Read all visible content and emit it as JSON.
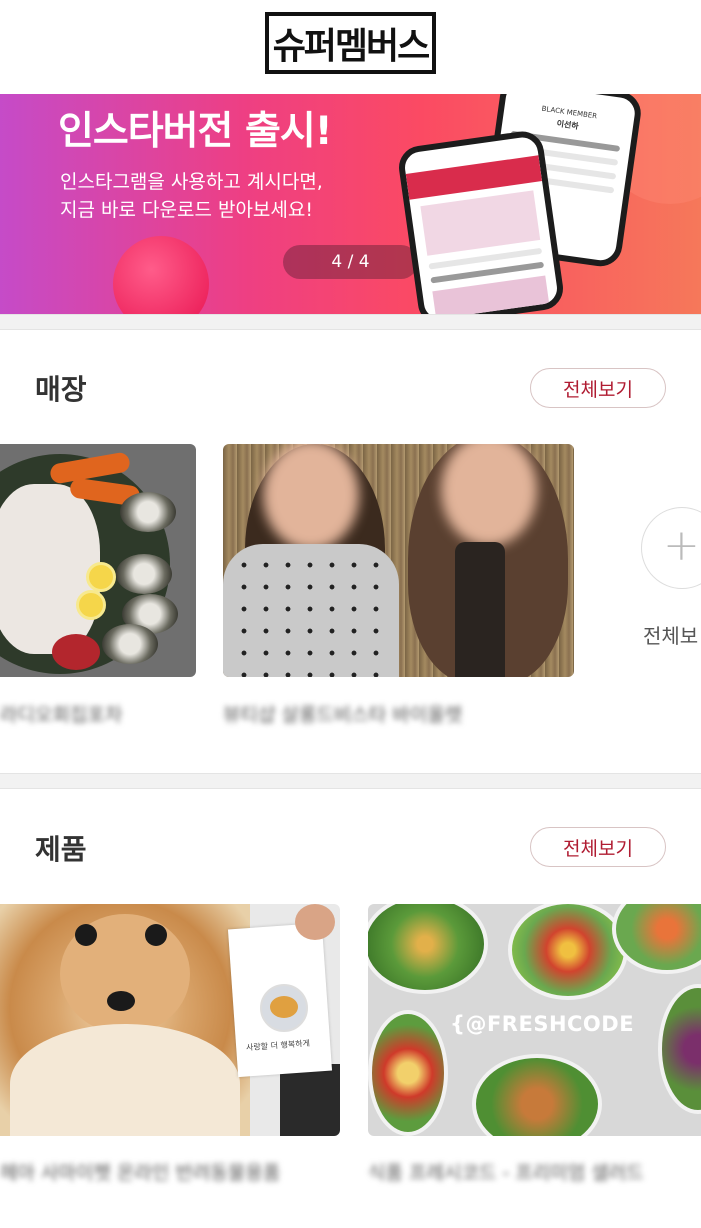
{
  "header": {
    "logo_text": "슈퍼멤버스"
  },
  "banner": {
    "title": "인스타버전 출시!",
    "subtitle_lines": [
      "인스타그램을 사용하고 계시다면,",
      "지금 바로 다운로드 받아보세요!"
    ],
    "pager": "4 / 4",
    "phone_back_label": "BLACK MEMBER",
    "phone_back_name": "이선하"
  },
  "stores": {
    "title": "매장",
    "view_all": "전체보기",
    "items": [
      {
        "caption": "라디오회집포차"
      },
      {
        "caption": "뷰티샵 살롱드비스타 바이올렛"
      }
    ],
    "more_label": "전체보"
  },
  "products": {
    "title": "제품",
    "view_all": "전체보기",
    "items": [
      {
        "caption": "헤아 사마이펫 온라인 반려동물용품",
        "tag_text": "사랑할 더 행복하게"
      },
      {
        "caption": "식품 프레시코드 - 프리미엄 샐러드",
        "brand": "FRESHCODE"
      }
    ]
  },
  "colors": {
    "accent": "#b01c32",
    "banner_start": "#c54bc8",
    "banner_end": "#f6785a"
  }
}
